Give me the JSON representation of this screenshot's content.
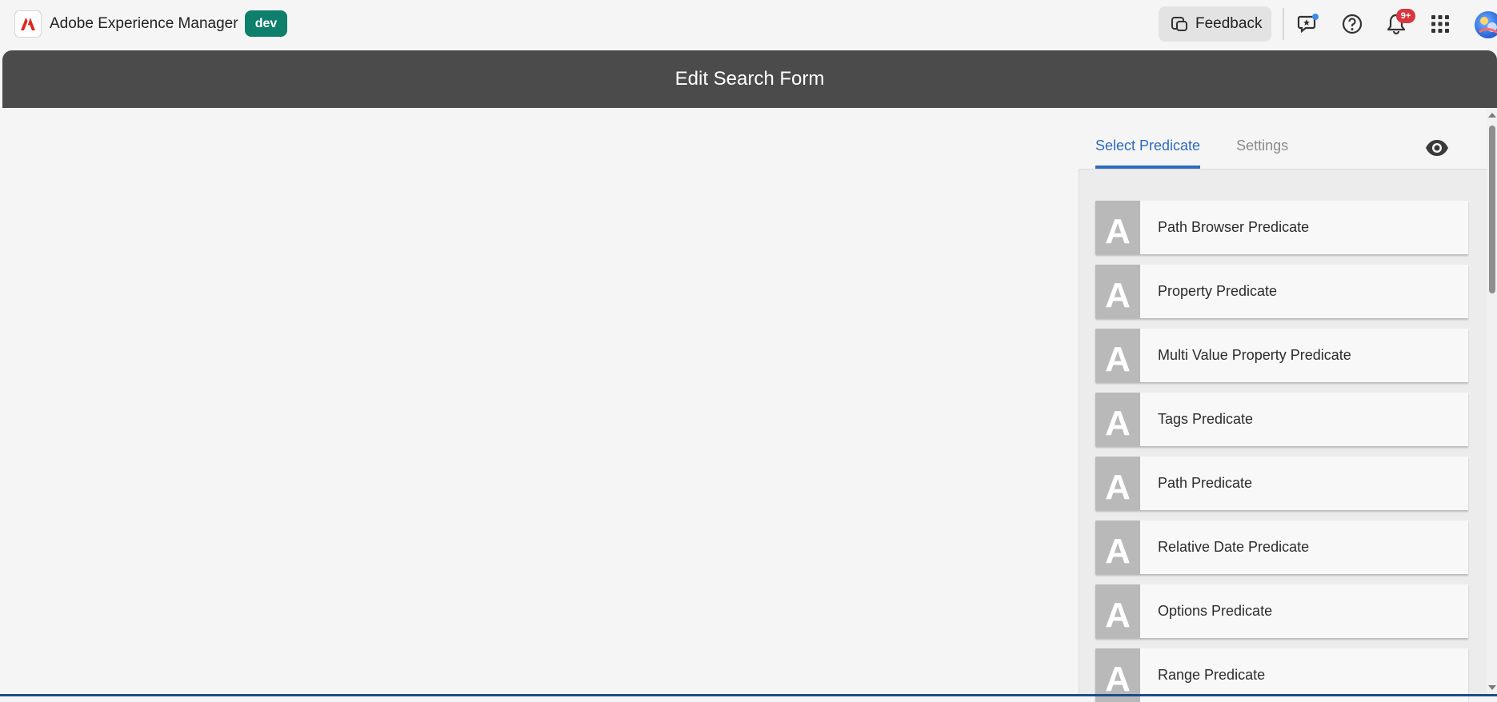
{
  "shell": {
    "app_name": "Adobe Experience Manager",
    "environment": "dev",
    "feedback_label": "Feedback",
    "notification_count": "9+",
    "icons": [
      "adobe-logo-icon",
      "feedback-icon",
      "chat-icon",
      "help-icon",
      "bell-icon",
      "apps-grid-icon",
      "user-avatar"
    ]
  },
  "page": {
    "title": "Edit Search Form"
  },
  "panel": {
    "tabs": [
      {
        "label": "Select Predicate",
        "active": true
      },
      {
        "label": "Settings",
        "active": false
      }
    ],
    "predicate_icon_letter": "A",
    "predicates": [
      {
        "label": "Path Browser Predicate"
      },
      {
        "label": "Property Predicate"
      },
      {
        "label": "Multi Value Property Predicate"
      },
      {
        "label": "Tags Predicate"
      },
      {
        "label": "Path Predicate"
      },
      {
        "label": "Relative Date Predicate"
      },
      {
        "label": "Options Predicate"
      },
      {
        "label": "Range Predicate"
      }
    ]
  },
  "colors": {
    "title_band": "#4b4b4b",
    "env_badge": "#0d7f6b",
    "active_tab": "#2c6bbd",
    "notification_badge": "#d7373f",
    "predicate_icon_bg": "#b9b9b9"
  }
}
